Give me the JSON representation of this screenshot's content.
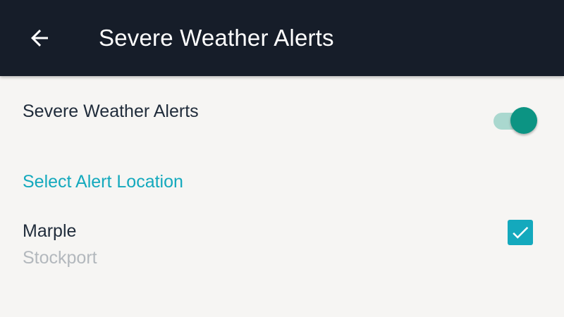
{
  "appbar": {
    "title": "Severe Weather Alerts",
    "back_icon": "arrow-back-icon",
    "background": "#161d29"
  },
  "settings": {
    "alerts_toggle": {
      "label": "Severe Weather Alerts",
      "enabled": true,
      "accent": "#0c9483"
    }
  },
  "location_section": {
    "header": "Select Alert Location",
    "accent": "#14a9bd",
    "items": [
      {
        "name": "Marple",
        "subtitle": "Stockport",
        "checked": true
      }
    ]
  }
}
